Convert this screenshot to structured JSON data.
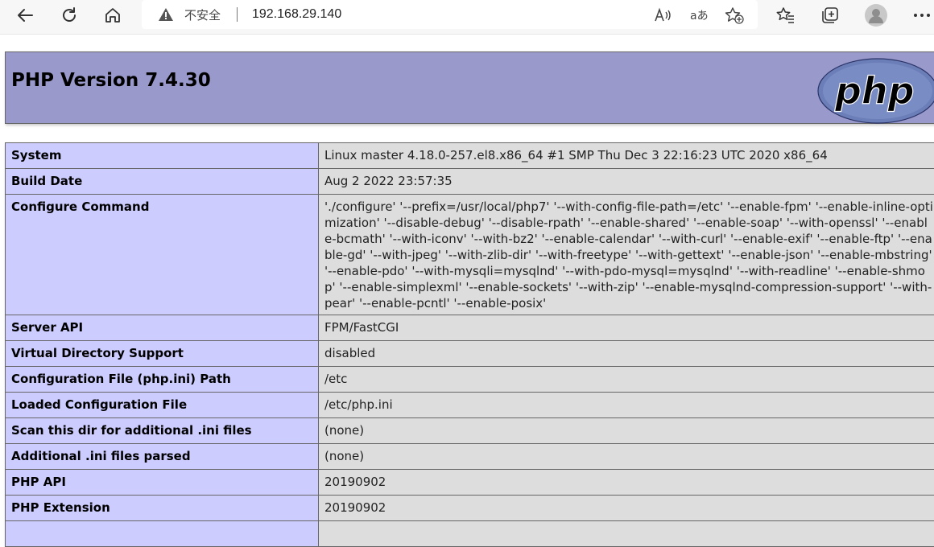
{
  "browser": {
    "insecure_label": "不安全",
    "url": "192.168.29.140"
  },
  "header": {
    "title": "PHP Version 7.4.30",
    "logo_text": "php"
  },
  "rows": [
    {
      "key": "System",
      "value": "Linux master 4.18.0-257.el8.x86_64 #1 SMP Thu Dec 3 22:16:23 UTC 2020 x86_64"
    },
    {
      "key": "Build Date",
      "value": "Aug 2 2022 23:57:35"
    },
    {
      "key": "Configure Command",
      "value": "'./configure' '--prefix=/usr/local/php7' '--with-config-file-path=/etc' '--enable-fpm' '--enable-inline-optimization' '--disable-debug' '--disable-rpath' '--enable-shared' '--enable-soap' '--with-openssl' '--enable-bcmath' '--with-iconv' '--with-bz2' '--enable-calendar' '--with-curl' '--enable-exif' '--enable-ftp' '--enable-gd' '--with-jpeg' '--with-zlib-dir' '--with-freetype' '--with-gettext' '--enable-json' '--enable-mbstring' '--enable-pdo' '--with-mysqli=mysqlnd' '--with-pdo-mysql=mysqlnd' '--with-readline' '--enable-shmop' '--enable-simplexml' '--enable-sockets' '--with-zip' '--enable-mysqlnd-compression-support' '--with-pear' '--enable-pcntl' '--enable-posix'"
    },
    {
      "key": "Server API",
      "value": "FPM/FastCGI"
    },
    {
      "key": "Virtual Directory Support",
      "value": "disabled"
    },
    {
      "key": "Configuration File (php.ini) Path",
      "value": "/etc"
    },
    {
      "key": "Loaded Configuration File",
      "value": "/etc/php.ini"
    },
    {
      "key": "Scan this dir for additional .ini files",
      "value": "(none)"
    },
    {
      "key": "Additional .ini files parsed",
      "value": "(none)"
    },
    {
      "key": "PHP API",
      "value": "20190902"
    },
    {
      "key": "PHP Extension",
      "value": "20190902"
    },
    {
      "key": "",
      "value": ""
    }
  ]
}
